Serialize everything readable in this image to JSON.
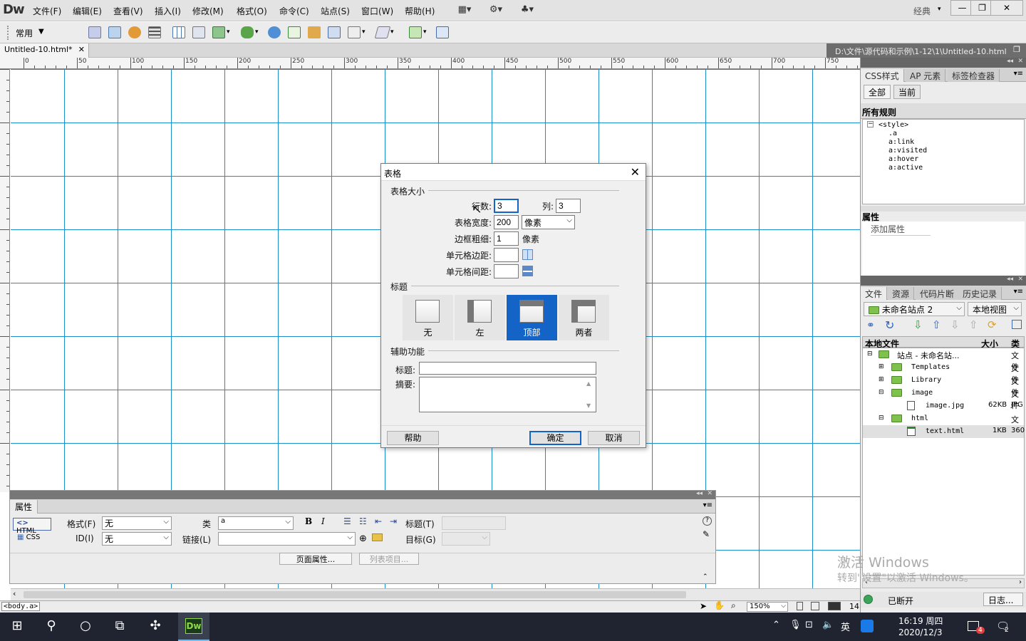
{
  "app": {
    "logo": "Dw",
    "layout_mode": "经典"
  },
  "menus": [
    "文件(F)",
    "编辑(E)",
    "查看(V)",
    "插入(I)",
    "修改(M)",
    "格式(O)",
    "命令(C)",
    "站点(S)",
    "窗口(W)",
    "帮助(H)"
  ],
  "toolbar": {
    "category": "常用"
  },
  "document": {
    "tab": "Untitled-10.html*",
    "path": "D:\\文件\\源代码和示例\\1-12\\1\\Untitled-10.html"
  },
  "ruler": {
    "labels": [
      "0",
      "50",
      "100",
      "150",
      "200",
      "250",
      "300",
      "350",
      "400",
      "450",
      "500",
      "550",
      "600",
      "650",
      "700",
      "750"
    ]
  },
  "dialog": {
    "title": "表格",
    "section_size": "表格大小",
    "rows_label": "行数:",
    "rows_value": "3",
    "cols_label": "列:",
    "cols_value": "3",
    "width_label": "表格宽度:",
    "width_value": "200",
    "width_unit": "像素",
    "border_label": "边框粗细:",
    "border_value": "1",
    "border_unit": "像素",
    "padding_label": "单元格边距:",
    "padding_value": "",
    "spacing_label": "单元格间距:",
    "spacing_value": "",
    "section_header": "标题",
    "header_options": [
      "无",
      "左",
      "顶部",
      "两者"
    ],
    "header_selected": "顶部",
    "section_access": "辅助功能",
    "caption_label": "标题:",
    "caption_value": "",
    "summary_label": "摘要:",
    "summary_value": "",
    "help": "帮助",
    "ok": "确定",
    "cancel": "取消"
  },
  "css_panel": {
    "tabs": [
      "CSS样式",
      "AP 元素",
      "标签检查器"
    ],
    "mode_all": "全部",
    "mode_current": "当前",
    "rules_title": "所有规则",
    "rules": [
      "<style>",
      ".a",
      "a:link",
      "a:visited",
      "a:hover",
      "a:active"
    ],
    "props_title": "属性",
    "add_prop": "添加属性"
  },
  "files_panel": {
    "tabs": [
      "文件",
      "资源",
      "代码片断",
      "历史记录"
    ],
    "site": "未命名站点 2",
    "view": "本地视图",
    "col_local": "本地文件",
    "col_size": "大小",
    "col_type": "类型",
    "tree": [
      {
        "name": "站点 - 未命名站...",
        "size": "",
        "type": "文件"
      },
      {
        "name": "Templates",
        "size": "",
        "type": "文件"
      },
      {
        "name": "Library",
        "size": "",
        "type": "文件"
      },
      {
        "name": "image",
        "size": "",
        "type": "文件"
      },
      {
        "name": "image.jpg",
        "size": "62KB",
        "type": "JPG"
      },
      {
        "name": "html",
        "size": "",
        "type": "文件"
      },
      {
        "name": "text.html",
        "size": "1KB",
        "type": "360"
      }
    ],
    "status": "已断开",
    "log": "日志..."
  },
  "props_panel": {
    "title": "属性",
    "html_btn": "HTML",
    "css_btn": "CSS",
    "format_label": "格式(F)",
    "format_value": "无",
    "id_label": "ID(I)",
    "id_value": "无",
    "class_label": "类",
    "class_value": "a",
    "link_label": "链接(L)",
    "link_value": "",
    "title_label": "标题(T)",
    "target_label": "目标(G)",
    "page_props": "页面属性...",
    "list_item": "列表项目...",
    "bold": "B",
    "italic": "I"
  },
  "status": {
    "tag": "<body.a>",
    "zoom": "150%",
    "size": "14"
  },
  "watermark": {
    "line1": "激活 Windows",
    "line2": "转到\"设置\"以激活 Windows。"
  },
  "taskbar": {
    "time": "16:19 周四",
    "date": "2020/12/3",
    "ime": "英",
    "notif": "4",
    "msg": "2",
    "dw": "Dw"
  }
}
